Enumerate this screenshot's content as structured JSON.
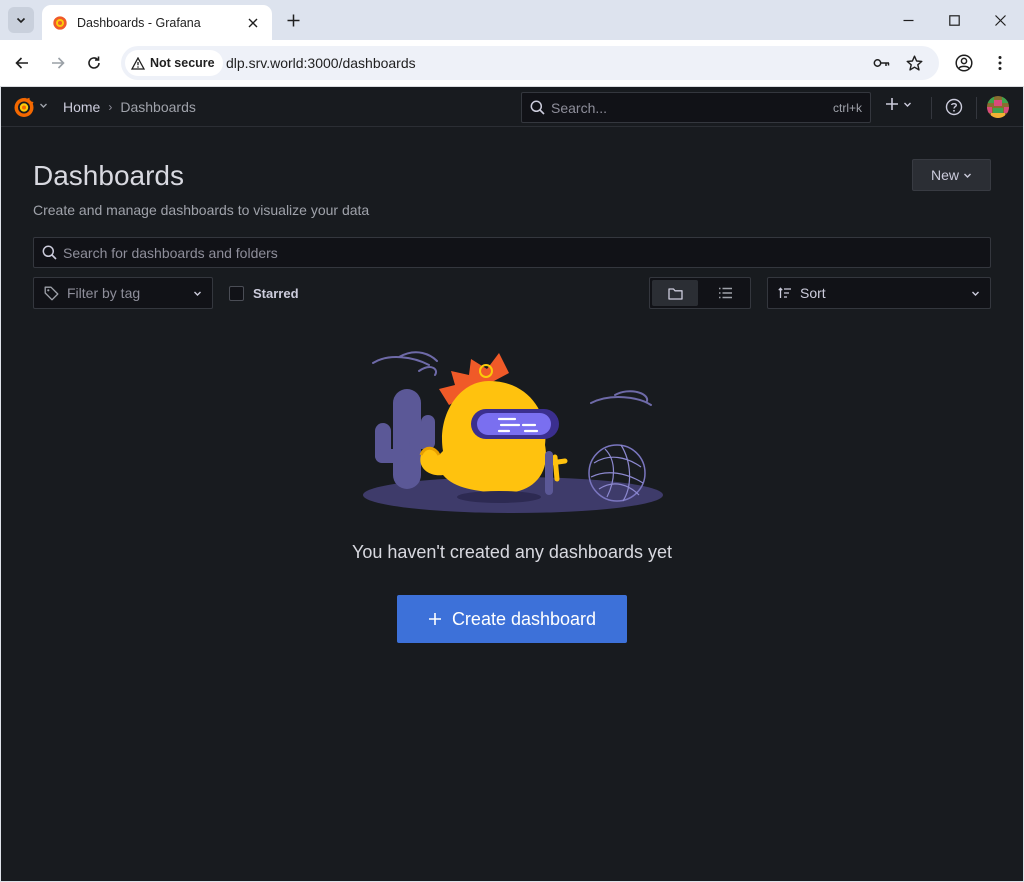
{
  "browser": {
    "tab": {
      "title": "Dashboards - Grafana",
      "favicon": "grafana-logo-icon"
    },
    "security_label": "Not secure",
    "url": "dlp.srv.world:3000/dashboards"
  },
  "topbar": {
    "breadcrumb": {
      "home": "Home",
      "current": "Dashboards"
    },
    "search_placeholder": "Search...",
    "search_shortcut": "ctrl+k"
  },
  "page": {
    "title": "Dashboards",
    "subtitle": "Create and manage dashboards to visualize your data",
    "new_button": "New"
  },
  "filters": {
    "search_placeholder": "Search for dashboards and folders",
    "tag_filter_placeholder": "Filter by tag",
    "starred_label": "Starred",
    "starred_checked": false,
    "view_mode": "folders",
    "sort_label": "Sort"
  },
  "empty_state": {
    "message": "You haven't created any dashboards yet",
    "create_button": "Create dashboard"
  },
  "colors": {
    "app_background": "#181b1f",
    "primary_button": "#3d71d9",
    "input_background": "#111217",
    "border": "#34373e"
  }
}
